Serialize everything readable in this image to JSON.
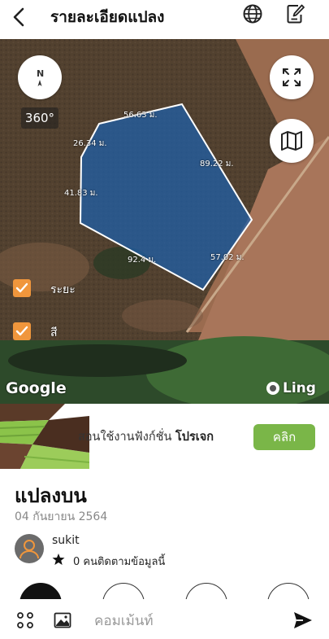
{
  "header": {
    "title": "รายละเอียดแปลง",
    "back_icon": "chevron-left-icon",
    "globe_icon": "globe-icon",
    "edit_icon": "edit-icon"
  },
  "map": {
    "compass_label": "N",
    "view_360_label": "360°",
    "distances": {
      "top": "56.63 ม.",
      "top_left": "26.34 ม.",
      "right": "89.22 ม.",
      "left": "41.83 ม.",
      "bottom": "92.4 ม.",
      "bottom_right": "57.02 ม."
    },
    "toggles": [
      {
        "label": "ระยะ",
        "checked": true
      },
      {
        "label": "สี",
        "checked": true
      }
    ],
    "attribution": "Google",
    "brand": "Ling",
    "polygon_color": "#1f5fa8"
  },
  "banner": {
    "text": "สอนใช้งานฟังก์ชั่น ",
    "text_bold": "โปรเจก",
    "cta_label": "คลิก",
    "cta_color": "#7ab648"
  },
  "plot": {
    "title": "แปลงบน",
    "date": "04 กันยายน 2564"
  },
  "owner": {
    "username": "sukit",
    "followers_text": "0 คนติดตามข้อมูลนี้"
  },
  "bottom_bar": {
    "comment_placeholder": "คอมเม้นท์"
  }
}
